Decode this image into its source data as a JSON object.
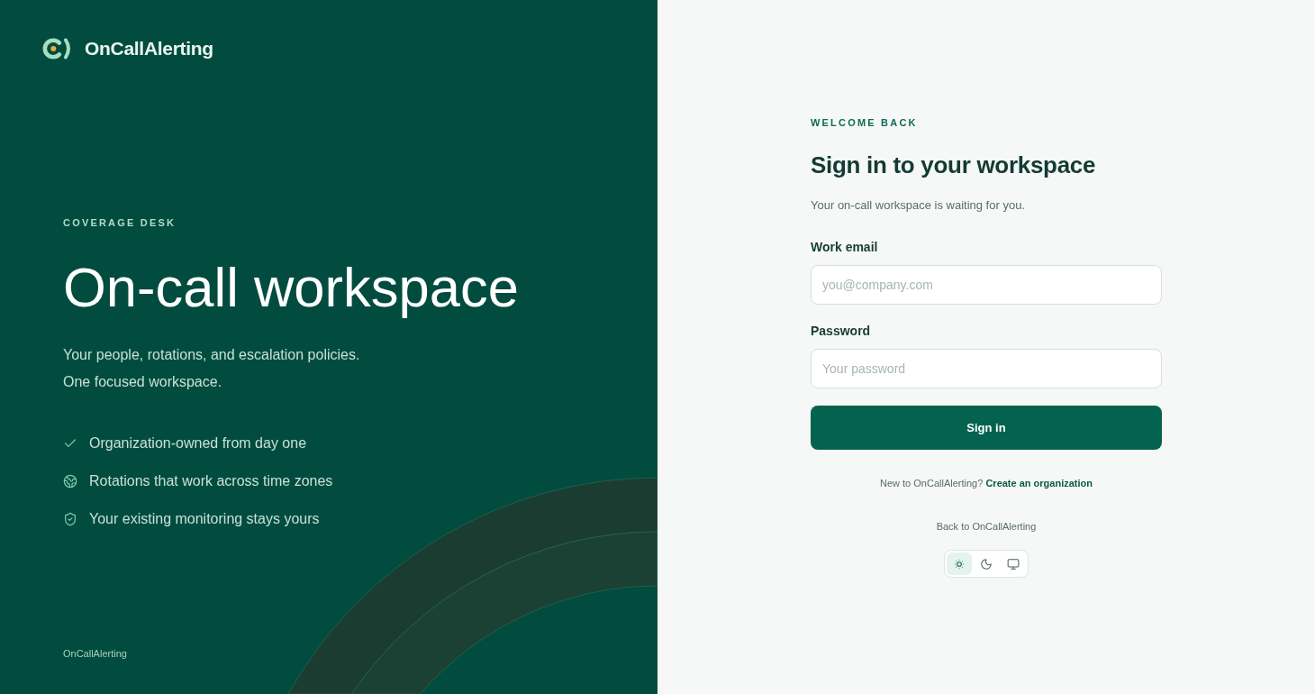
{
  "brand": {
    "name": "OnCallAlerting"
  },
  "hero": {
    "eyebrow": "COVERAGE DESK",
    "title": "On-call workspace",
    "description": "Your people, rotations, and escalation policies. One focused workspace.",
    "features": [
      "Organization-owned from day one",
      "Rotations that work across time zones",
      "Your existing monitoring stays yours"
    ]
  },
  "footer": {
    "text": "OnCallAlerting"
  },
  "form": {
    "eyebrow": "WELCOME BACK",
    "title": "Sign in to your workspace",
    "subtitle": "Your on-call workspace is waiting for you.",
    "fields": [
      {
        "label": "Work email",
        "placeholder": "you@company.com"
      },
      {
        "label": "Password",
        "placeholder": "Your password"
      }
    ],
    "submit": "Sign in",
    "signup_prompt": "New to OnCallAlerting?",
    "signup_link": "Create an organization",
    "back_link": "Back to OnCallAlerting",
    "theme_options": [
      {
        "selected": true
      },
      {
        "selected": false
      },
      {
        "selected": false
      }
    ]
  }
}
